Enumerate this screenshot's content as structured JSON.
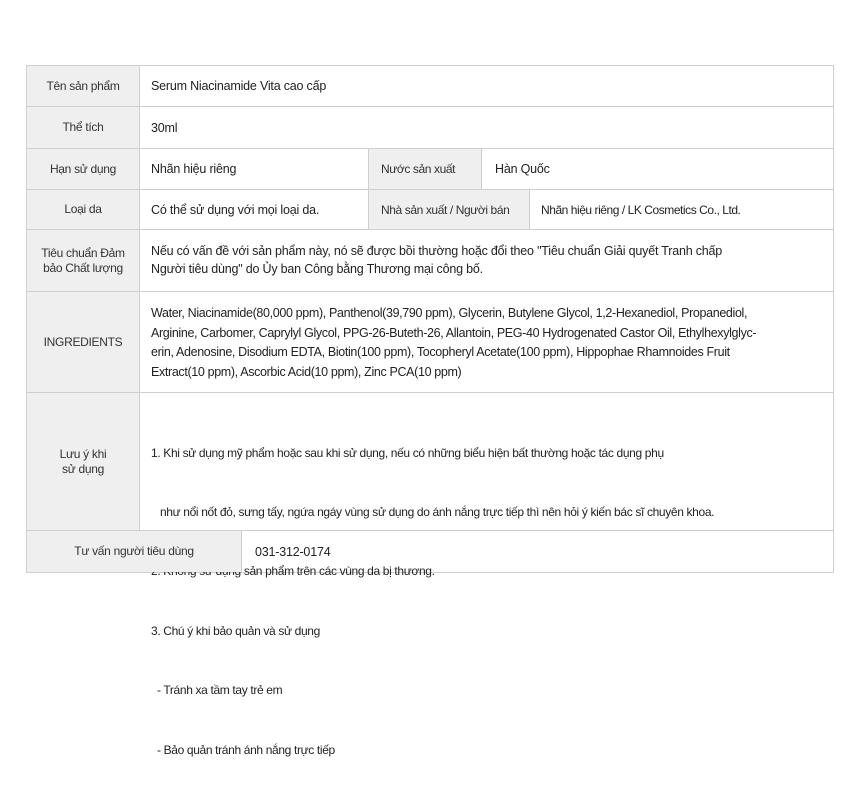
{
  "rows": {
    "product_name": {
      "label": "Tên sản phẩm",
      "value": "Serum Niacinamide Vita cao cấp"
    },
    "volume": {
      "label": "Thể tích",
      "value": "30ml"
    },
    "expiry": {
      "label": "Hạn sử dụng",
      "value": "Nhãn hiệu riêng",
      "label2": "Nước sản xuất",
      "value2": "Hàn Quốc"
    },
    "skin_type": {
      "label": "Loại da",
      "value": "Có thể sử dụng với mọi loại da.",
      "label2": "Nhà sản xuất / Người bán",
      "value2": "Nhãn hiệu riêng / LK Cosmetics Co., Ltd."
    },
    "quality": {
      "label_line1": "Tiêu chuẩn Đảm",
      "label_line2": "bảo Chất lượng",
      "lines": [
        "Nếu có vấn đề với sản phẩm này, nó sẽ được bồi thường hoặc đổi theo \"Tiêu chuẩn Giải quyết Tranh chấp",
        "Người tiêu dùng\" do Ủy ban Công bằng Thương mại công bố."
      ]
    },
    "ingredients": {
      "label": "INGREDIENTS",
      "lines": [
        "Water, Niacinamide(80,000 ppm), Panthenol(39,790 ppm), Glycerin, Butylene Glycol, 1,2-Hexanediol, Propanediol,",
        "Arginine, Carbomer, Caprylyl Glycol, PPG-26-Buteth-26, Allantoin, PEG-40 Hydrogenated Castor Oil, Ethylhexylglyc-",
        "erin, Adenosine, Disodium EDTA, Biotin(100 ppm), Tocopheryl Acetate(100 ppm), Hippophae Rhamnoides Fruit",
        "Extract(10 ppm), Ascorbic Acid(10 ppm), Zinc PCA(10 ppm)"
      ]
    },
    "caution": {
      "label_line1": "Lưu ý khi",
      "label_line2": "sử dụng",
      "lines": [
        "1. Khi sử dụng mỹ phẩm hoặc sau khi sử dụng, nếu có những biểu hiện bất thường hoặc tác dụng phụ",
        "   như nổi nốt đỏ, sưng tấy, ngứa ngáy vùng sử dụng do ánh nắng trực tiếp thì nên hỏi ý kiến bác sĩ chuyên khoa.",
        "2. Không sử dụng sản phẩm trên các vùng da bị thương.",
        "3. Chú ý khi bảo quản và sử dụng",
        "  - Tránh xa tầm tay trẻ em",
        "  - Bảo quản tránh ánh nắng trực tiếp"
      ]
    },
    "consult": {
      "label": "Tư vấn người tiêu dùng",
      "value": "031-312-0174"
    }
  }
}
